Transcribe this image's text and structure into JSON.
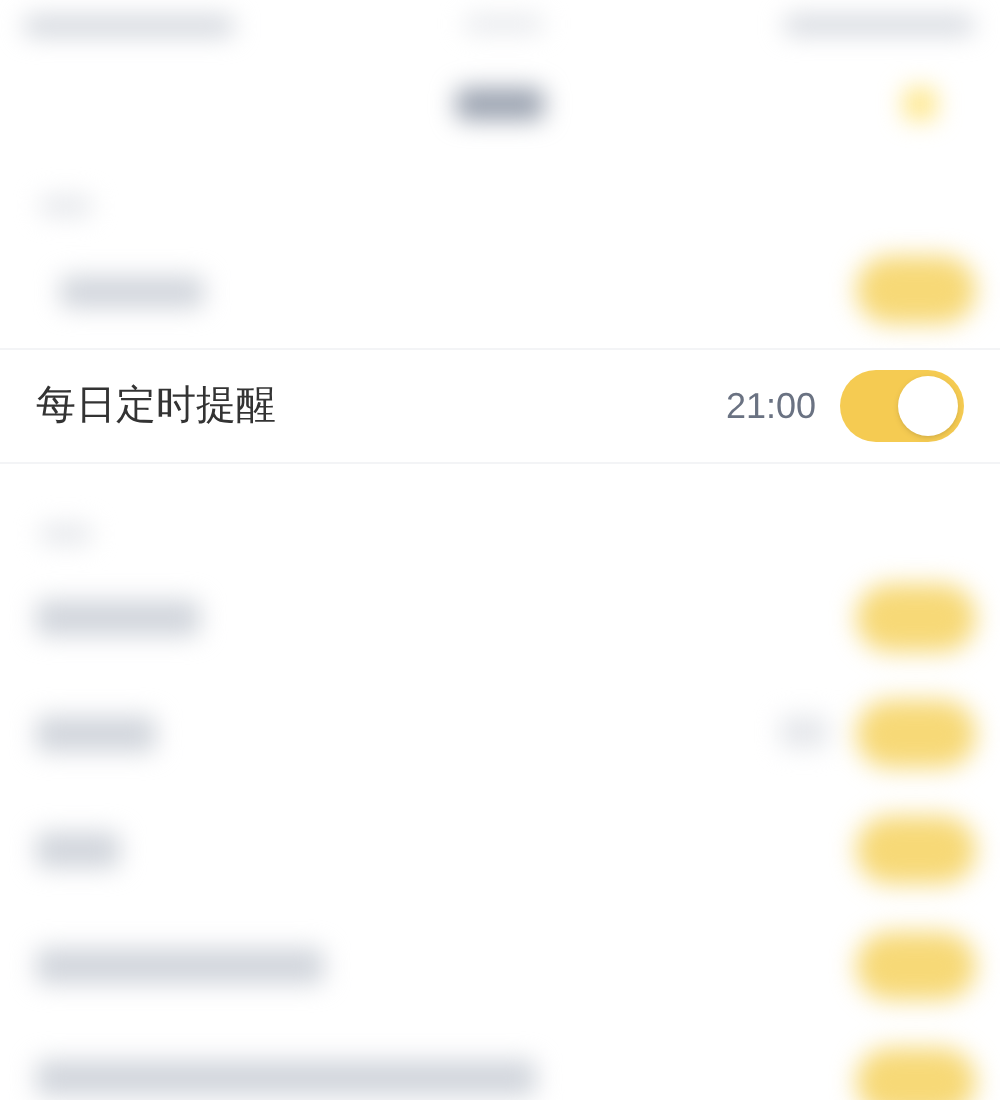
{
  "reminder_row": {
    "label": "每日定时提醒",
    "time": "21:00",
    "on": true
  }
}
